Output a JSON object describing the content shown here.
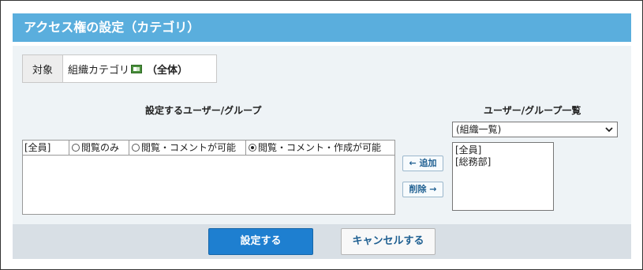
{
  "title": "アクセス権の設定（カテゴリ）",
  "target": {
    "label": "対象",
    "category": "組織カテゴリ",
    "category_icon": "category-icon",
    "scope": "（全体）"
  },
  "selected_section": {
    "heading": "設定するユーザー/グループ",
    "rows": [
      {
        "who": "[全員]",
        "options": [
          {
            "label": "閲覧のみ",
            "checked": false
          },
          {
            "label": "閲覧・コメントが可能",
            "checked": false
          },
          {
            "label": "閲覧・コメント・作成が可能",
            "checked": true
          }
        ]
      }
    ]
  },
  "buttons": {
    "add": "← 追加",
    "remove": "削除 →",
    "submit": "設定する",
    "cancel": "キャンセルする"
  },
  "list_section": {
    "heading": "ユーザー/グループ一覧",
    "dropdown_value": "(組織一覧)",
    "items": [
      "[全員]",
      "[総務部]"
    ]
  },
  "colors": {
    "title_bar": "#5aaedd",
    "primary_button": "#1e7fd0"
  }
}
